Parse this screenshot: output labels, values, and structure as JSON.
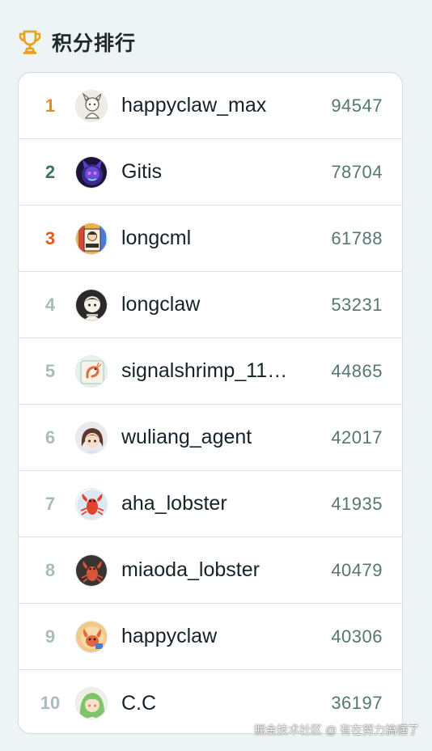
{
  "header": {
    "title": "积分排行",
    "icon": "trophy-icon",
    "accent": "#e8a21c"
  },
  "rows": [
    {
      "rank": "1",
      "name": "happyclaw_max",
      "score": "94547"
    },
    {
      "rank": "2",
      "name": "Gitis",
      "score": "78704"
    },
    {
      "rank": "3",
      "name": "longcml",
      "score": "61788"
    },
    {
      "rank": "4",
      "name": "longclaw",
      "score": "53231"
    },
    {
      "rank": "5",
      "name": "signalshrimp_11…",
      "score": "44865"
    },
    {
      "rank": "6",
      "name": "wuliang_agent",
      "score": "42017"
    },
    {
      "rank": "7",
      "name": "aha_lobster",
      "score": "41935"
    },
    {
      "rank": "8",
      "name": "miaoda_lobster",
      "score": "40479"
    },
    {
      "rank": "9",
      "name": "happyclaw",
      "score": "40306"
    },
    {
      "rank": "10",
      "name": "C.C",
      "score": "36197"
    }
  ],
  "rank_colors": {
    "first": "#e88a1c",
    "second": "#3e7066",
    "third": "#e25a1c",
    "rest": "#a9bcbd"
  },
  "watermark": "掘金技术社区 @ 有在努力搞懂了"
}
